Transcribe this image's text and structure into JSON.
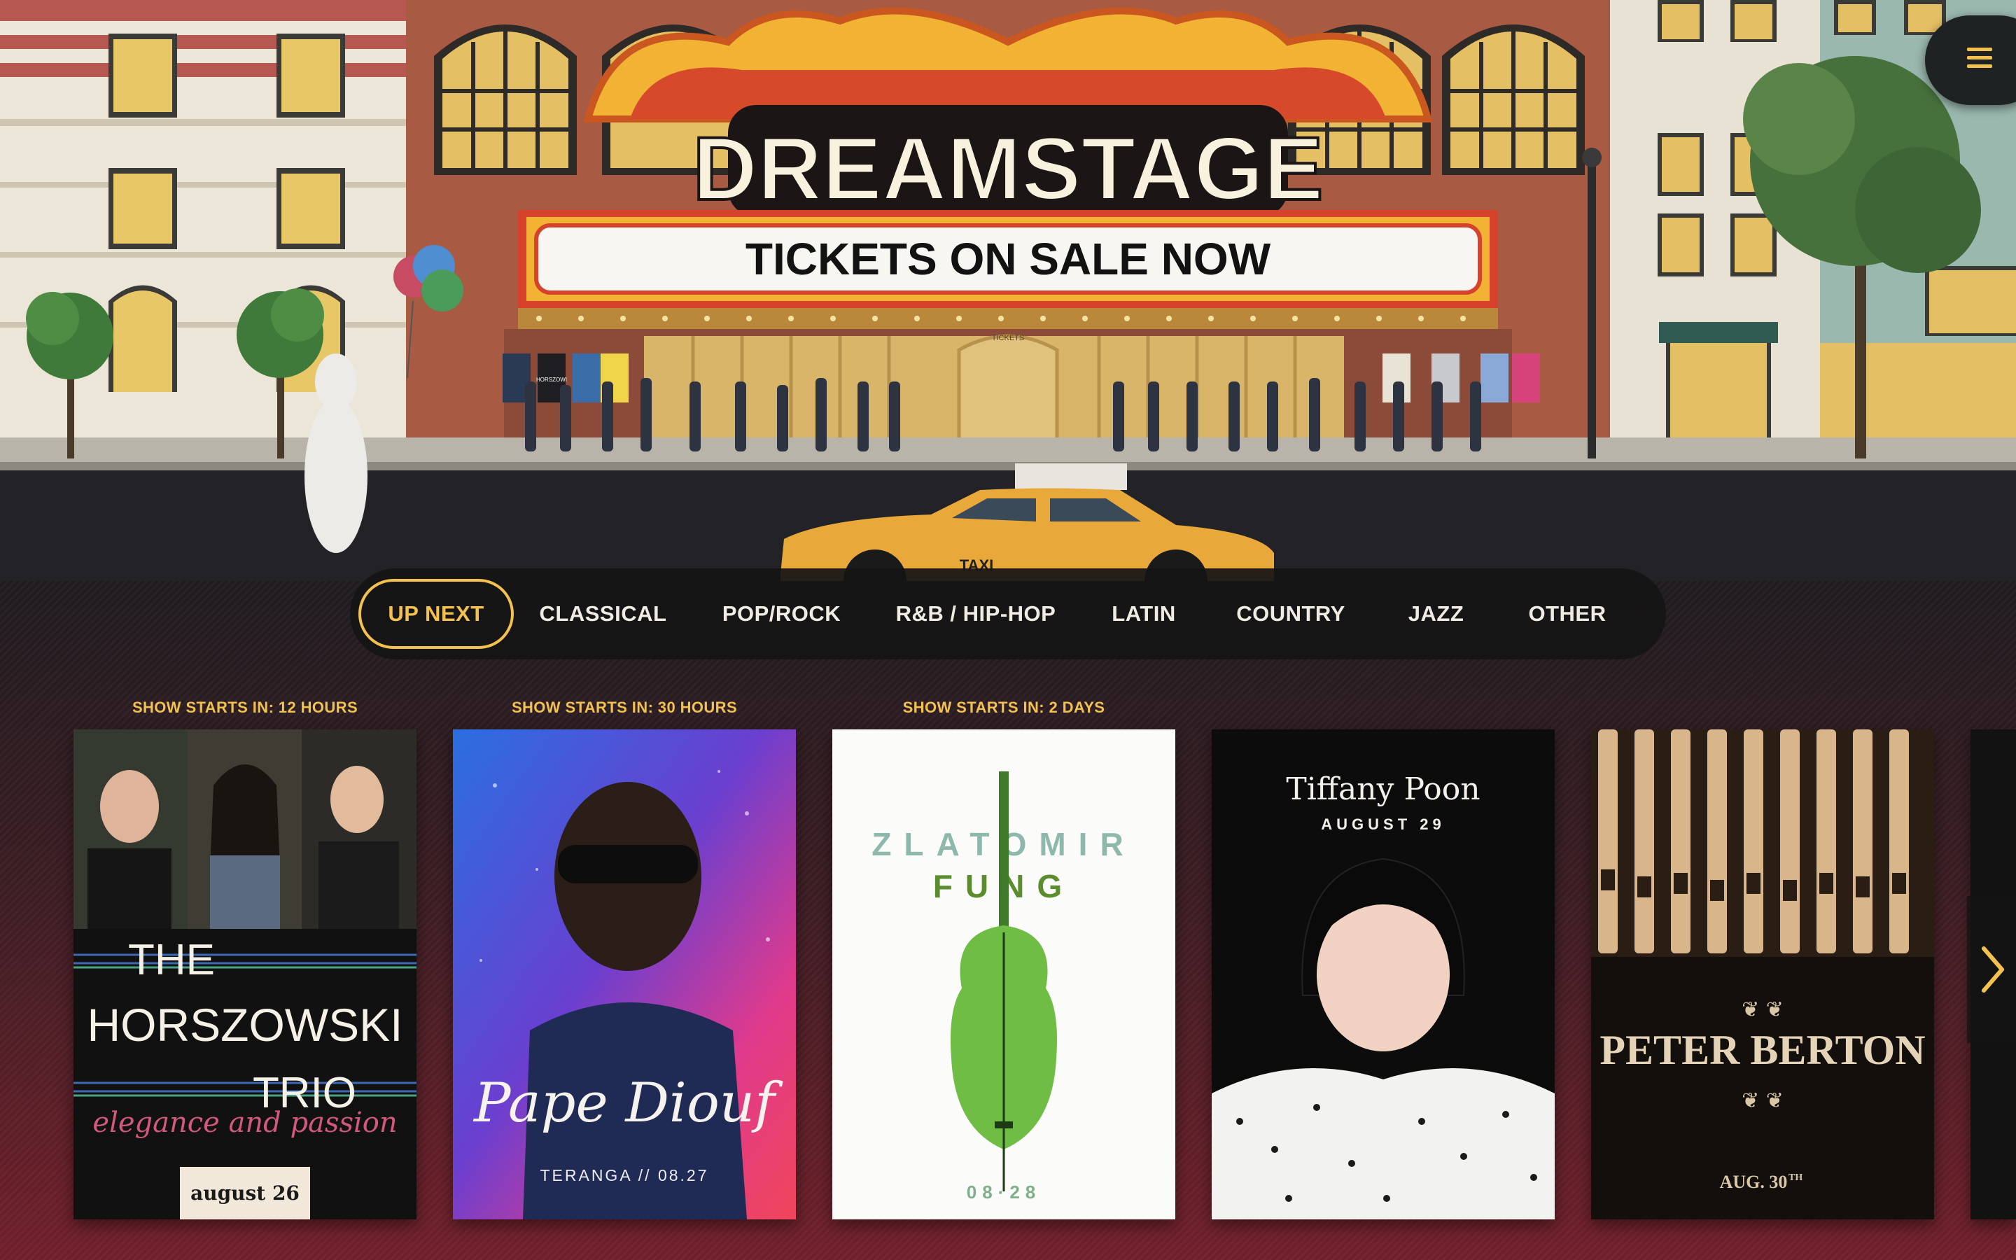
{
  "header": {
    "brand": "DREAMSTAGE",
    "marquee_text": "TICKETS ON SALE NOW",
    "tickets_sign": "TICKETS",
    "poster_text": "HORSZOWI",
    "taxi_text": "TAXI"
  },
  "menu": {
    "icon": "hamburger-menu-icon"
  },
  "nav": {
    "tabs": [
      {
        "label": "UP NEXT",
        "active": true
      },
      {
        "label": "CLASSICAL"
      },
      {
        "label": "POP/ROCK"
      },
      {
        "label": "R&B / HIP-HOP"
      },
      {
        "label": "LATIN"
      },
      {
        "label": "COUNTRY"
      },
      {
        "label": "JAZZ"
      },
      {
        "label": "OTHER"
      }
    ]
  },
  "shows": [
    {
      "countdown": "SHOW STARTS IN: 12 HOURS",
      "title_lines": [
        "THE",
        "HORSZOWSKI",
        "TRIO"
      ],
      "subtitle": "elegance and passion",
      "date": "august 26"
    },
    {
      "countdown": "SHOW STARTS IN: 30 HOURS",
      "title": "Pape Diouf",
      "date": "TERANGA // 08.27"
    },
    {
      "countdown": "SHOW STARTS IN: 2 DAYS",
      "title_lines": [
        "ZLATOMIR",
        "FUNG"
      ],
      "date": "08·28"
    },
    {
      "countdown": "",
      "title": "Tiffany Poon",
      "date": "AUGUST 29"
    },
    {
      "countdown": "",
      "title": "PETER BERTON",
      "date": "AUG. 30",
      "date_sup": "TH"
    }
  ],
  "colors": {
    "accent": "#f2c14e",
    "nav_bg": "#161416",
    "brick": "#a85a43",
    "marquee_red": "#d6422b"
  }
}
